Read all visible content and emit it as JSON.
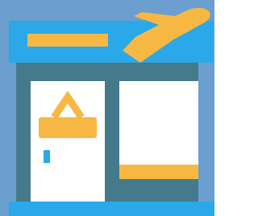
{
  "icon": {
    "name": "airport-travel-agency-icon",
    "parts": [
      "roof-sign",
      "sign-banner",
      "airplane-icon",
      "building-facade",
      "door",
      "hanging-sign-icon",
      "door-handle",
      "shop-window",
      "window-counter",
      "sidewalk"
    ]
  },
  "colors": {
    "background": "#6a9fd0",
    "roof": "#2aa8e8",
    "wall": "#457a8c",
    "accent": "#f7b843",
    "panel": "#ffffff",
    "handle": "#2aa8e8",
    "ground": "#2aa8e8"
  }
}
